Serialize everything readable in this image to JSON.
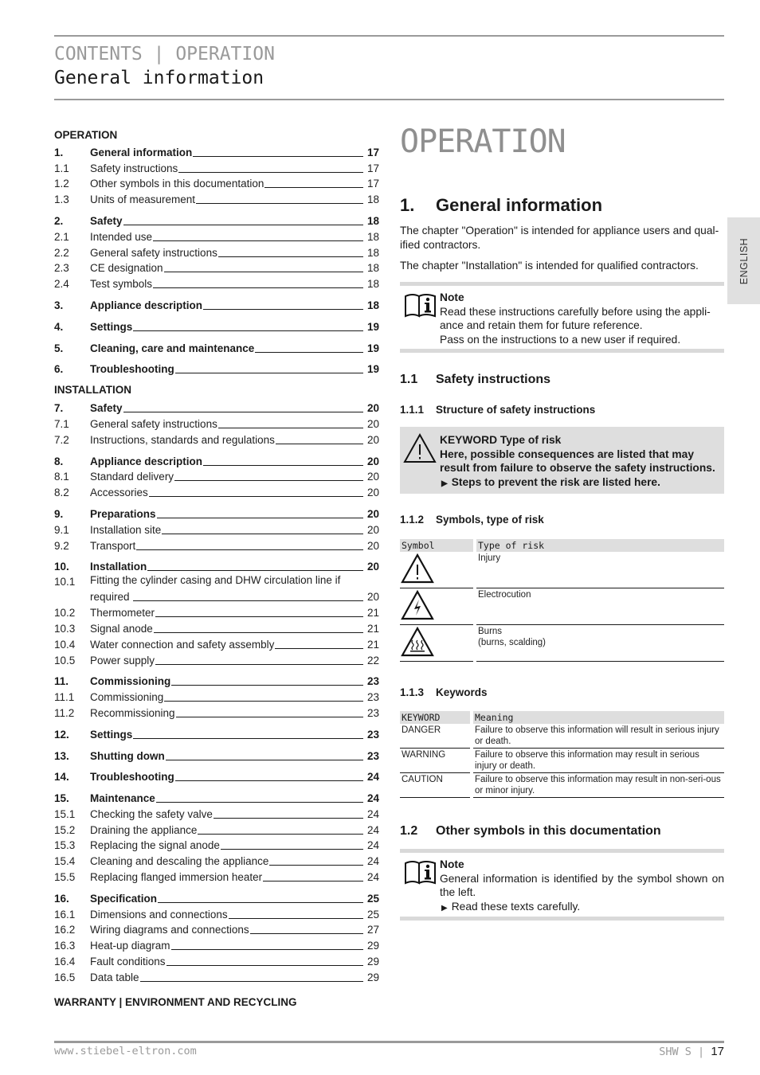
{
  "header": {
    "line1": "CONTENTS | OPERATION",
    "line2": "General information"
  },
  "toc": {
    "operation_label": "OPERATION",
    "installation_label": "INSTALLATION",
    "warranty_label": "WARRANTY | ENVIRONMENT AND RECYCLING",
    "operation": [
      {
        "num": "1.",
        "title": "General information",
        "page": "17",
        "main": true
      },
      {
        "num": "1.1",
        "title": "Safety instructions",
        "page": "17"
      },
      {
        "num": "1.2",
        "title": "Other symbols in this documentation",
        "page": "17"
      },
      {
        "num": "1.3",
        "title": "Units of measurement",
        "page": "18"
      },
      {
        "num": "2.",
        "title": "Safety",
        "page": "18",
        "main": true
      },
      {
        "num": "2.1",
        "title": "Intended use",
        "page": "18"
      },
      {
        "num": "2.2",
        "title": "General safety instructions",
        "page": "18"
      },
      {
        "num": "2.3",
        "title": "CE designation",
        "page": "18"
      },
      {
        "num": "2.4",
        "title": "Test symbols",
        "page": "18"
      },
      {
        "num": "3.",
        "title": "Appliance description",
        "page": "18",
        "main": true
      },
      {
        "num": "4.",
        "title": "Settings",
        "page": "19",
        "main": true
      },
      {
        "num": "5.",
        "title": "Cleaning, care and maintenance",
        "page": "19",
        "main": true
      },
      {
        "num": "6.",
        "title": "Troubleshooting",
        "page": "19",
        "main": true
      }
    ],
    "installation": [
      {
        "num": "7.",
        "title": "Safety",
        "page": "20",
        "main": true
      },
      {
        "num": "7.1",
        "title": "General safety instructions",
        "page": "20"
      },
      {
        "num": "7.2",
        "title": "Instructions, standards and regulations",
        "page": "20"
      },
      {
        "num": "8.",
        "title": "Appliance description",
        "page": "20",
        "main": true
      },
      {
        "num": "8.1",
        "title": "Standard delivery",
        "page": "20"
      },
      {
        "num": "8.2",
        "title": "Accessories",
        "page": "20"
      },
      {
        "num": "9.",
        "title": "Preparations",
        "page": "20",
        "main": true
      },
      {
        "num": "9.1",
        "title": "Installation site",
        "page": "20"
      },
      {
        "num": "9.2",
        "title": "Transport",
        "page": "20"
      },
      {
        "num": "10.",
        "title": "Installation",
        "page": "20",
        "main": true
      },
      {
        "num": "10.1",
        "title": "Fitting the cylinder casing and DHW circulation line if",
        "title2": "required",
        "page": "20"
      },
      {
        "num": "10.2",
        "title": "Thermometer",
        "page": "21"
      },
      {
        "num": "10.3",
        "title": "Signal anode",
        "page": "21"
      },
      {
        "num": "10.4",
        "title": "Water connection and safety assembly",
        "page": "21"
      },
      {
        "num": "10.5",
        "title": "Power supply",
        "page": "22"
      },
      {
        "num": "11.",
        "title": "Commissioning",
        "page": "23",
        "main": true
      },
      {
        "num": "11.1",
        "title": "Commissioning",
        "page": "23"
      },
      {
        "num": "11.2",
        "title": "Recommissioning",
        "page": "23"
      },
      {
        "num": "12.",
        "title": "Settings",
        "page": "23",
        "main": true
      },
      {
        "num": "13.",
        "title": "Shutting down",
        "page": "23",
        "main": true
      },
      {
        "num": "14.",
        "title": "Troubleshooting",
        "page": "24",
        "main": true
      },
      {
        "num": "15.",
        "title": "Maintenance",
        "page": "24",
        "main": true
      },
      {
        "num": "15.1",
        "title": "Checking the safety valve",
        "page": "24"
      },
      {
        "num": "15.2",
        "title": "Draining the appliance",
        "page": "24"
      },
      {
        "num": "15.3",
        "title": "Replacing the signal anode",
        "page": "24"
      },
      {
        "num": "15.4",
        "title": "Cleaning and descaling the appliance",
        "page": "24"
      },
      {
        "num": "15.5",
        "title": "Replacing flanged immersion heater",
        "page": "24"
      },
      {
        "num": "16.",
        "title": "Specification",
        "page": "25",
        "main": true
      },
      {
        "num": "16.1",
        "title": "Dimensions and connections",
        "page": "25"
      },
      {
        "num": "16.2",
        "title": "Wiring diagrams and connections",
        "page": "27"
      },
      {
        "num": "16.3",
        "title": "Heat-up diagram",
        "page": "29"
      },
      {
        "num": "16.4",
        "title": "Fault conditions",
        "page": "29"
      },
      {
        "num": "16.5",
        "title": "Data table",
        "page": "29"
      }
    ]
  },
  "content": {
    "big_title": "OPERATION",
    "section1": {
      "num": "1.",
      "title": "General information"
    },
    "para1": "The chapter \"Operation\" is intended for appliance users and qual-ified contractors.",
    "para2": "The chapter \"Installation\" is intended for qualified contractors.",
    "note1": {
      "label": "Note",
      "lines": [
        "Read these instructions carefully before using the appli-ance and retain them for future reference.",
        "Pass on the instructions to a new user if required."
      ]
    },
    "section1_1": {
      "num": "1.1",
      "title": "Safety instructions"
    },
    "section1_1_1": {
      "num": "1.1.1",
      "title": "Structure of safety instructions"
    },
    "warning_box": {
      "keyword_line": "KEYWORD Type of risk",
      "consequence": "Here, possible consequences are listed that may result from failure to observe the safety instructions.",
      "step": "Steps to prevent the risk are listed here."
    },
    "section1_1_2": {
      "num": "1.1.2",
      "title": "Symbols, type of risk"
    },
    "risk_table": {
      "headers": [
        "Symbol",
        "Type of risk"
      ],
      "rows": [
        {
          "icon": "warning-exclamation-icon",
          "text": "Injury",
          "text2": ""
        },
        {
          "icon": "electrocution-icon",
          "text": "Electrocution",
          "text2": ""
        },
        {
          "icon": "hot-surface-icon",
          "text": "Burns",
          "text2": "(burns, scalding)"
        }
      ]
    },
    "section1_1_3": {
      "num": "1.1.3",
      "title": "Keywords"
    },
    "keyword_table": {
      "headers": [
        "KEYWORD",
        "Meaning"
      ],
      "rows": [
        {
          "keyword": "DANGER",
          "meaning": "Failure to observe this information will result in serious injury or death."
        },
        {
          "keyword": "WARNING",
          "meaning": "Failure to observe this information may result in serious injury or death."
        },
        {
          "keyword": "CAUTION",
          "meaning": "Failure to observe this information may result in non-seri-ous or minor injury."
        }
      ]
    },
    "section1_2": {
      "num": "1.2",
      "title": "Other symbols in this documentation"
    },
    "note2": {
      "label": "Note",
      "line1": "General information is identified by the symbol shown on the left.",
      "step": "Read these texts carefully."
    }
  },
  "side_tab": {
    "label": "ENGLISH"
  },
  "footer": {
    "url": "www.stiebel-eltron.com",
    "product": "SHW S",
    "separator": "|",
    "page": "17"
  }
}
